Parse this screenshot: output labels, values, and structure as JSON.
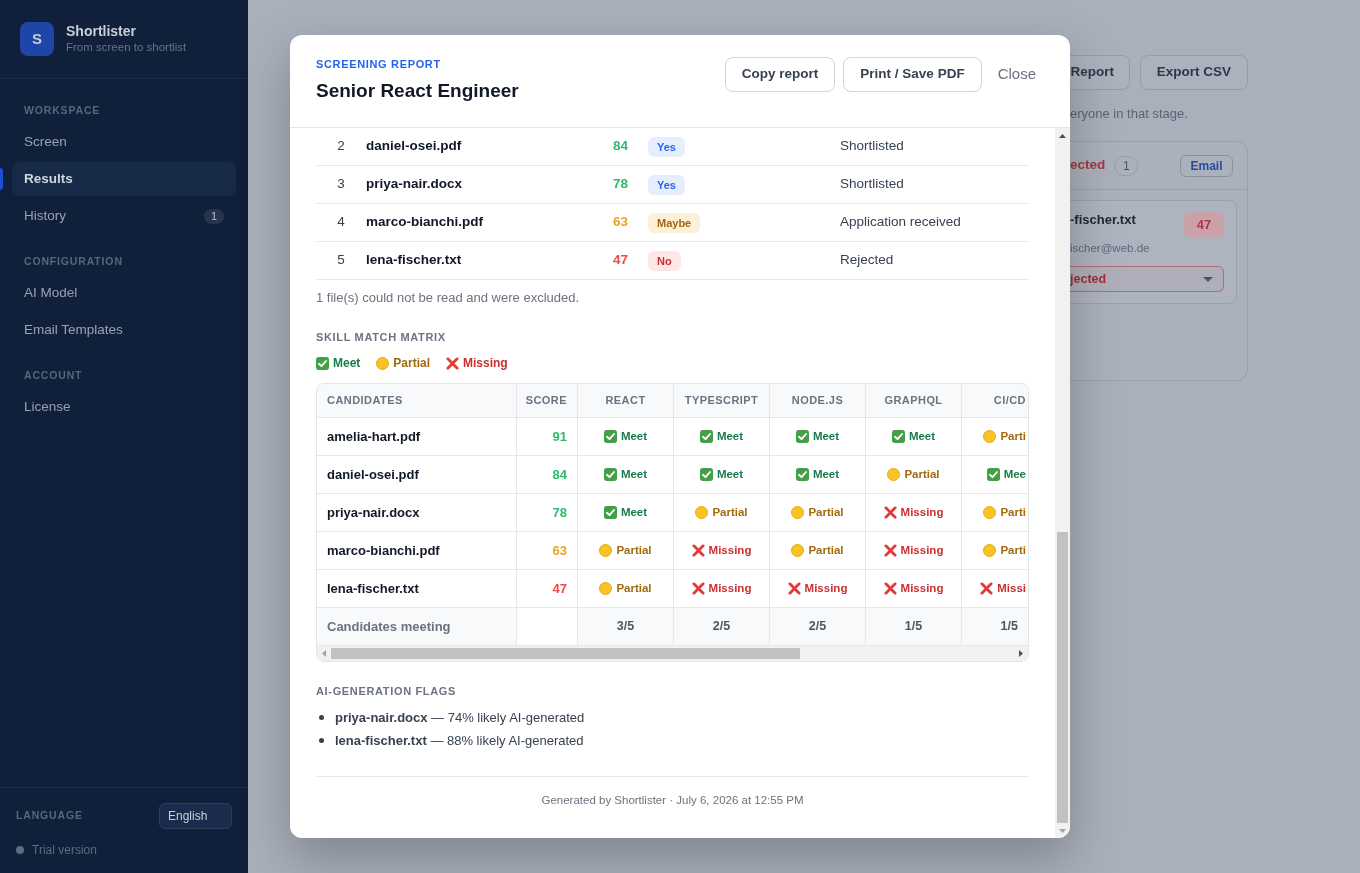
{
  "sidebar": {
    "brand": {
      "logo_letter": "S",
      "name": "Shortlister",
      "tagline": "From screen to shortlist"
    },
    "sections": [
      {
        "heading": "WORKSPACE",
        "items": [
          {
            "label": "Screen",
            "selected": false
          },
          {
            "label": "Results",
            "selected": true
          },
          {
            "label": "History",
            "selected": false,
            "badge": "1"
          }
        ]
      },
      {
        "heading": "CONFIGURATION",
        "items": [
          {
            "label": "AI Model",
            "selected": false
          },
          {
            "label": "Email Templates",
            "selected": false
          }
        ]
      },
      {
        "heading": "ACCOUNT",
        "items": [
          {
            "label": "License",
            "selected": false
          }
        ]
      }
    ],
    "language": {
      "label": "LANGUAGE",
      "value": "English"
    },
    "plan": "Trial version"
  },
  "background": {
    "buttons": [
      "Report",
      "Export CSV"
    ],
    "hint": "eryone in that stage.",
    "stage_column": {
      "title": "ected",
      "count": "1",
      "action": "Email",
      "card": {
        "name": "-fischer.txt",
        "score": "47",
        "email": "ischer@web.de",
        "status": "jected"
      }
    }
  },
  "modal": {
    "eyebrow": "SCREENING REPORT",
    "title": "Senior React Engineer",
    "actions": [
      {
        "label": "Copy report",
        "kind": "outlined"
      },
      {
        "label": "Print / Save PDF",
        "kind": "outlined"
      },
      {
        "label": "Close",
        "kind": "plain"
      }
    ],
    "ranking": {
      "rows": [
        {
          "rank": "2",
          "file": "daniel-osei.pdf",
          "score": "84",
          "kind": "high",
          "verdict": {
            "label": "Yes",
            "kind": "yes"
          },
          "status": "Shortlisted"
        },
        {
          "rank": "3",
          "file": "priya-nair.docx",
          "score": "78",
          "kind": "high",
          "verdict": {
            "label": "Yes",
            "kind": "yes"
          },
          "status": "Shortlisted"
        },
        {
          "rank": "4",
          "file": "marco-bianchi.pdf",
          "score": "63",
          "kind": "medium",
          "verdict": {
            "label": "Maybe",
            "kind": "maybe"
          },
          "status": "Application received"
        },
        {
          "rank": "5",
          "file": "lena-fischer.txt",
          "score": "47",
          "kind": "low",
          "verdict": {
            "label": "No",
            "kind": "no"
          },
          "status": "Rejected"
        }
      ],
      "note": "1 file(s) could not be read and were excluded."
    },
    "skill_matrix": {
      "heading": "SKILL MATCH MATRIX",
      "legend": [
        {
          "kind": "meet",
          "label": "Meet"
        },
        {
          "kind": "partial",
          "label": "Partial"
        },
        {
          "kind": "missing",
          "label": "Missing"
        }
      ],
      "columns": [
        "CANDIDATES",
        "SCORE",
        "REACT",
        "TYPESCRIPT",
        "NODE.JS",
        "GRAPHQL",
        "CI/CD"
      ],
      "rows": [
        {
          "kind": "high",
          "cells": [
            {
              "kind": "name",
              "text": "amelia-hart.pdf"
            },
            {
              "kind": "score",
              "text": "91"
            },
            {
              "kind": "meet",
              "text": "Meet"
            },
            {
              "kind": "meet",
              "text": "Meet"
            },
            {
              "kind": "meet",
              "text": "Meet"
            },
            {
              "kind": "meet",
              "text": "Meet"
            },
            {
              "kind": "partial",
              "text": "Parti"
            }
          ]
        },
        {
          "kind": "high",
          "cells": [
            {
              "kind": "name",
              "text": "daniel-osei.pdf"
            },
            {
              "kind": "score",
              "text": "84"
            },
            {
              "kind": "meet",
              "text": "Meet"
            },
            {
              "kind": "meet",
              "text": "Meet"
            },
            {
              "kind": "meet",
              "text": "Meet"
            },
            {
              "kind": "partial",
              "text": "Partial"
            },
            {
              "kind": "meet",
              "text": "Mee"
            }
          ]
        },
        {
          "kind": "high",
          "cells": [
            {
              "kind": "name",
              "text": "priya-nair.docx"
            },
            {
              "kind": "score",
              "text": "78"
            },
            {
              "kind": "meet",
              "text": "Meet"
            },
            {
              "kind": "partial",
              "text": "Partial"
            },
            {
              "kind": "partial",
              "text": "Partial"
            },
            {
              "kind": "missing",
              "text": "Missing"
            },
            {
              "kind": "partial",
              "text": "Parti"
            }
          ]
        },
        {
          "kind": "medium",
          "cells": [
            {
              "kind": "name",
              "text": "marco-bianchi.pdf"
            },
            {
              "kind": "score",
              "text": "63"
            },
            {
              "kind": "partial",
              "text": "Partial"
            },
            {
              "kind": "missing",
              "text": "Missing"
            },
            {
              "kind": "partial",
              "text": "Partial"
            },
            {
              "kind": "missing",
              "text": "Missing"
            },
            {
              "kind": "partial",
              "text": "Parti"
            }
          ]
        },
        {
          "kind": "low",
          "cells": [
            {
              "kind": "name",
              "text": "lena-fischer.txt"
            },
            {
              "kind": "score",
              "text": "47"
            },
            {
              "kind": "partial",
              "text": "Partial"
            },
            {
              "kind": "missing",
              "text": "Missing"
            },
            {
              "kind": "missing",
              "text": "Missing"
            },
            {
              "kind": "missing",
              "text": "Missing"
            },
            {
              "kind": "missing",
              "text": "Missi"
            }
          ]
        }
      ],
      "footer": {
        "cells": [
          "Candidates meeting",
          "",
          "3/5",
          "2/5",
          "2/5",
          "1/5",
          "1/5"
        ]
      }
    },
    "ai_flags": {
      "heading": "AI-GENERATION FLAGS",
      "items": [
        "**priya-nair.docx** — 74% likely AI-generated",
        "**lena-fischer.txt** — 88% likely AI-generated"
      ]
    },
    "footer": "Generated by Shortlister · July 6, 2026 at 12:55 PM"
  }
}
